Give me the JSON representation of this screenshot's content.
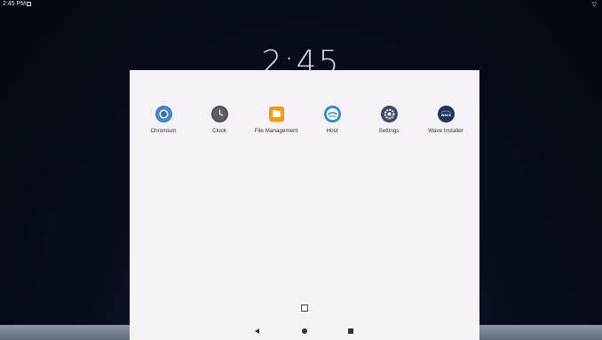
{
  "status_bar": {
    "time": "2:45 PM"
  },
  "lockscreen": {
    "clock": "2:45"
  },
  "drawer": {
    "apps": [
      {
        "label": "Chromium",
        "icon": "chromium-icon"
      },
      {
        "label": "Clock",
        "icon": "clock-icon"
      },
      {
        "label": "File Management",
        "icon": "folder-icon"
      },
      {
        "label": "Host",
        "icon": "host-icon"
      },
      {
        "label": "Settings",
        "icon": "gear-icon"
      },
      {
        "label": "Wave Installer",
        "icon": "wave-installer-icon",
        "icon_text": "WAVE"
      }
    ]
  },
  "navigation": {
    "back": "back-icon",
    "home": "home-icon",
    "overview": "overview-icon"
  },
  "colors": {
    "drawer_bg": "#f4f2f4",
    "chromium_blue": "#4a90e2",
    "file_orange": "#f39c12",
    "host_blue": "#1e88e5",
    "settings_navy": "#3b4a6b",
    "wave_navy": "#1f3458"
  }
}
